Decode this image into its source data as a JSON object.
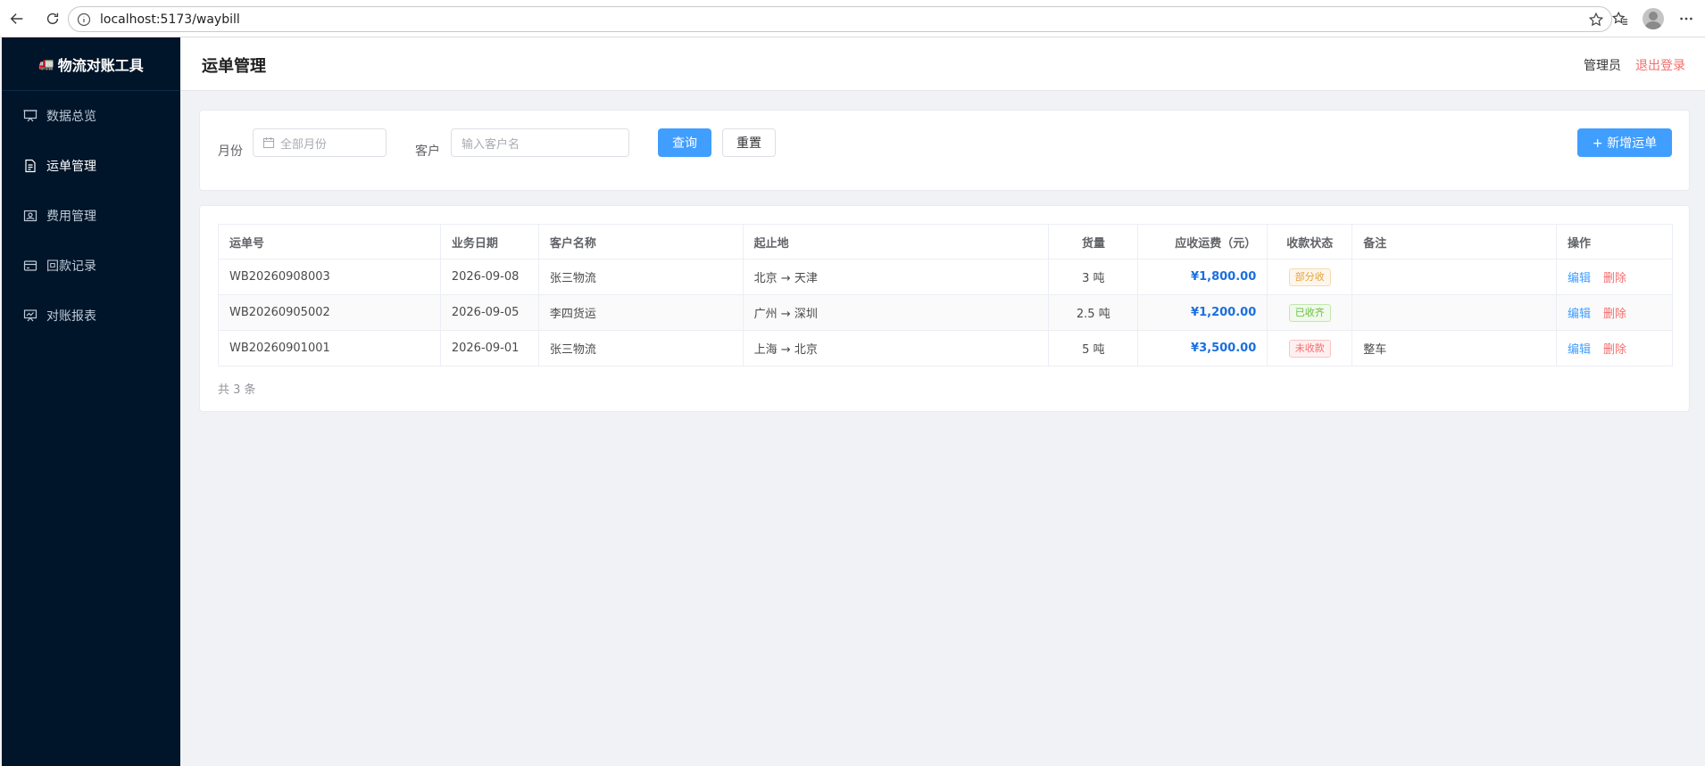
{
  "browser": {
    "url": "localhost:5173/waybill"
  },
  "sidebar": {
    "brand": "物流对账工具",
    "items": [
      {
        "label": "数据总览",
        "icon": "presentation-icon",
        "active": false
      },
      {
        "label": "运单管理",
        "icon": "document-icon",
        "active": true
      },
      {
        "label": "费用管理",
        "icon": "money-icon",
        "active": false
      },
      {
        "label": "回款记录",
        "icon": "card-icon",
        "active": false
      },
      {
        "label": "对账报表",
        "icon": "report-icon",
        "active": false
      }
    ]
  },
  "header": {
    "title": "运单管理",
    "user_role": "管理员",
    "logout_label": "退出登录"
  },
  "filters": {
    "month_label": "月份",
    "month_placeholder": "全部月份",
    "customer_label": "客户",
    "customer_placeholder": "输入客户名",
    "query_label": "查询",
    "reset_label": "重置",
    "add_label": "+ 新增运单"
  },
  "table": {
    "columns": [
      "运单号",
      "业务日期",
      "客户名称",
      "起止地",
      "货量",
      "应收运费（元）",
      "收款状态",
      "备注",
      "操作"
    ],
    "rows": [
      {
        "waybill_no": "WB20260908003",
        "date": "2026-09-08",
        "customer": "张三物流",
        "route": "北京 → 天津",
        "volume": "3 吨",
        "fee": "¥1,800.00",
        "status": "部分收",
        "remark": "",
        "edit": "编辑",
        "delete": "删除"
      },
      {
        "waybill_no": "WB20260905002",
        "date": "2026-09-05",
        "customer": "李四货运",
        "route": "广州 → 深圳",
        "volume": "2.5 吨",
        "fee": "¥1,200.00",
        "status": "已收齐",
        "remark": "",
        "edit": "编辑",
        "delete": "删除"
      },
      {
        "waybill_no": "WB20260901001",
        "date": "2026-09-01",
        "customer": "张三物流",
        "route": "上海 → 北京",
        "volume": "5 吨",
        "fee": "¥3,500.00",
        "status": "未收款",
        "remark": "整车",
        "edit": "编辑",
        "delete": "删除"
      }
    ],
    "status_colors": {
      "部分收": {
        "fg": "#e6a23c",
        "bg": "#fdf6ec",
        "border": "#f5dab1"
      },
      "已收齐": {
        "fg": "#67c23a",
        "bg": "#f0f9eb",
        "border": "#c2e7b0"
      },
      "未收款": {
        "fg": "#f56c6c",
        "bg": "#fef0f0",
        "border": "#fbc4c4"
      }
    },
    "total_text": "共 3 条"
  }
}
